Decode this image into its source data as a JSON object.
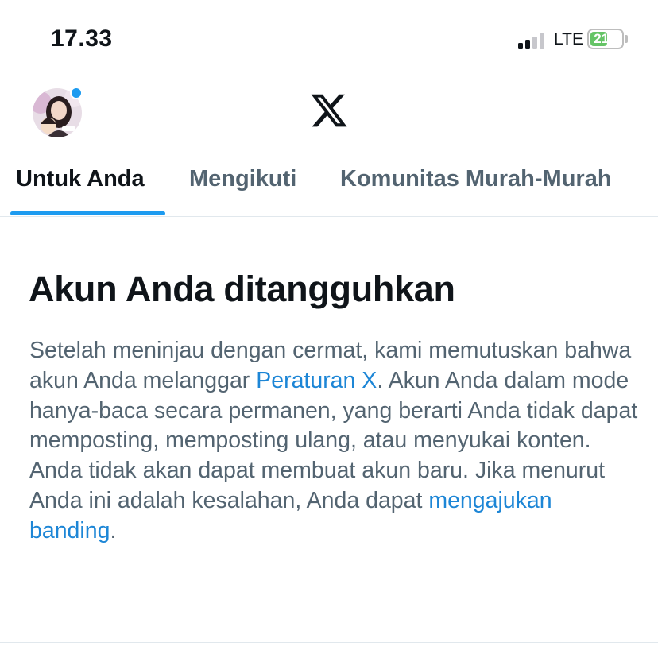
{
  "status_bar": {
    "time": "17.33",
    "network": "LTE",
    "battery_level": "21"
  },
  "header": {
    "logo": "x-logo-icon",
    "avatar": "profile-avatar",
    "notification_dot": true
  },
  "tabs": [
    {
      "label": "Untuk Anda",
      "active": true
    },
    {
      "label": "Mengikuti",
      "active": false
    },
    {
      "label": "Komunitas Murah-Murah",
      "active": false
    }
  ],
  "notice": {
    "title": "Akun Anda ditangguhkan",
    "text_1": "Setelah meninjau dengan cermat, kami memutuskan bahwa akun Anda melanggar ",
    "link_1": "Peraturan X",
    "text_2": ". Akun Anda dalam mode hanya-baca secara permanen, yang berarti Anda tidak dapat memposting, memposting ulang, atau menyukai konten. Anda tidak akan dapat membuat akun baru. Jika menurut Anda ini adalah kesalahan, Anda dapat ",
    "link_2": "mengajukan banding",
    "text_3": "."
  },
  "colors": {
    "accent": "#1d9bf0",
    "link": "#1d86d6",
    "text_primary": "#0f1419",
    "text_secondary": "#536471",
    "battery_green": "#65c466",
    "divider": "#e1e8ed"
  }
}
